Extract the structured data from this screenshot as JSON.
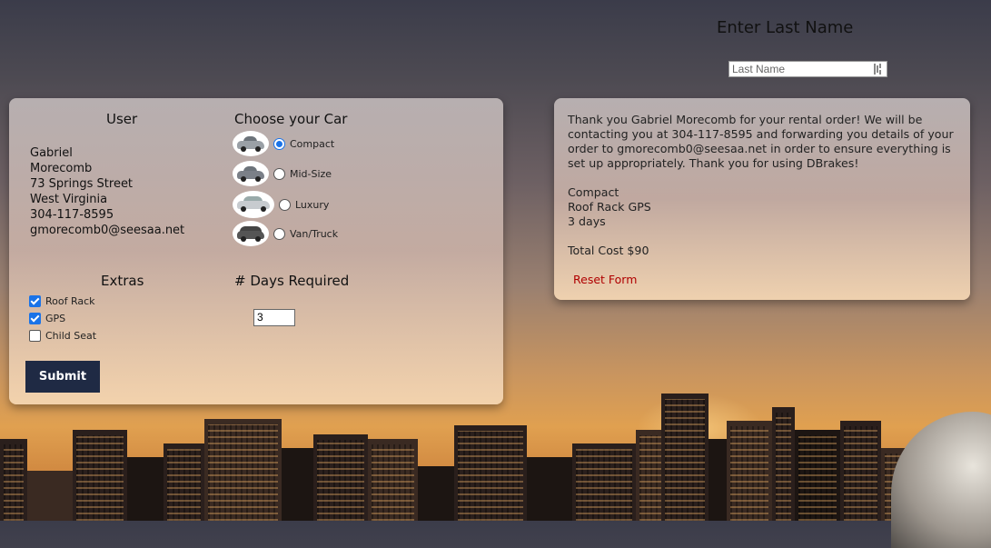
{
  "lookup": {
    "title": "Enter Last Name",
    "last_name_placeholder": "Last Name"
  },
  "form": {
    "user_heading": "User",
    "user": {
      "first_name": "Gabriel",
      "last_name": "Morecomb",
      "street": "73 Springs Street",
      "state": "West Virginia",
      "phone": "304-117-8595",
      "email": "gmorecomb0@seesaa.net"
    },
    "car_heading": "Choose your Car",
    "cars": [
      {
        "label": "Compact",
        "selected": true
      },
      {
        "label": "Mid-Size",
        "selected": false
      },
      {
        "label": "Luxury",
        "selected": false
      },
      {
        "label": "Van/Truck",
        "selected": false
      }
    ],
    "extras_heading": "Extras",
    "extras": [
      {
        "label": "Roof Rack",
        "checked": true
      },
      {
        "label": "GPS",
        "checked": true
      },
      {
        "label": "Child Seat",
        "checked": false
      }
    ],
    "days_heading": "# Days Required",
    "days_value": "3",
    "submit_label": "Submit"
  },
  "confirmation": {
    "message": "Thank you Gabriel Morecomb for your rental order! We will be contacting you at 304-117-8595 and forwarding you details of your order to gmorecomb0@seesaa.net in order to ensure everything is set up appropriately. Thank you for using DBrakes!",
    "car": "Compact",
    "extras": "Roof Rack GPS",
    "days": "3 days",
    "total": "Total Cost $90",
    "reset_label": "Reset Form"
  },
  "colors": {
    "submit_bg": "#1f2a44",
    "reset_link": "#b00000",
    "accent": "#1a73e8"
  }
}
